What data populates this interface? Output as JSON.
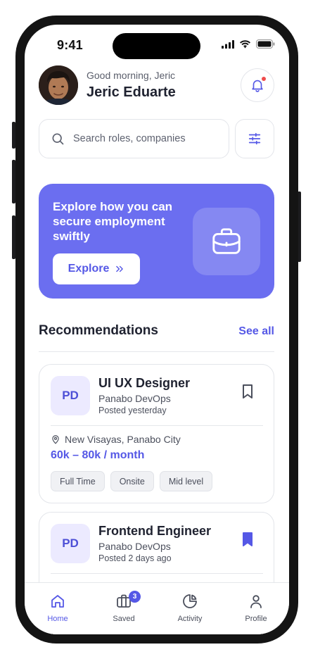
{
  "status_bar": {
    "time": "9:41"
  },
  "header": {
    "greeting": "Good morning, Jeric",
    "user_name": "Jeric Eduarte"
  },
  "search": {
    "placeholder": "Search roles, companies"
  },
  "banner": {
    "title": "Explore how you can secure employment swiftly",
    "button_label": "Explore"
  },
  "recommendations": {
    "title": "Recommendations",
    "see_all_label": "See all",
    "jobs": [
      {
        "logo_text": "PD",
        "title": "UI UX Designer",
        "company": "Panabo DevOps",
        "posted": "Posted yesterday",
        "location": "New Visayas, Panabo City",
        "salary": "60k – 80k / month",
        "tags": [
          "Full Time",
          "Onsite",
          "Mid level"
        ],
        "bookmarked": false
      },
      {
        "logo_text": "PD",
        "title": "Frontend Engineer",
        "company": "Panabo DevOps",
        "posted": "Posted 2 days ago",
        "bookmarked": true
      }
    ]
  },
  "bottom_nav": {
    "items": [
      {
        "label": "Home",
        "icon": "home-icon",
        "active": true
      },
      {
        "label": "Saved",
        "icon": "briefcase-icon",
        "badge": "3"
      },
      {
        "label": "Activity",
        "icon": "pie-chart-icon"
      },
      {
        "label": "Profile",
        "icon": "user-icon"
      }
    ]
  },
  "colors": {
    "accent": "#5558e6",
    "banner": "#6b6ef0",
    "notification_dot": "#ef4b4b",
    "logo_tile": "#eceaff"
  }
}
